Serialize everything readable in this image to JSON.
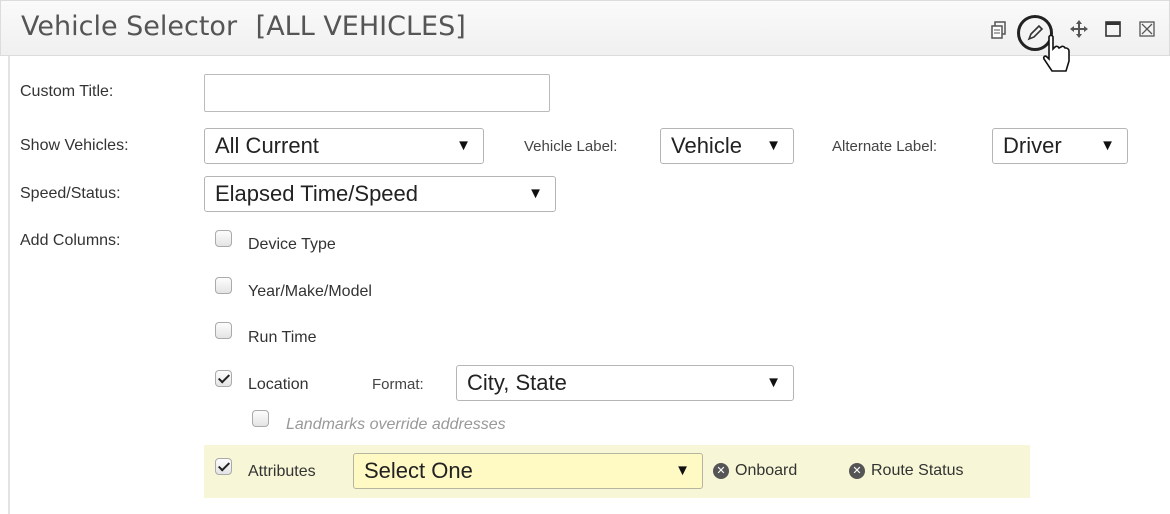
{
  "header": {
    "title": "Vehicle Selector",
    "title_tag": "[ALL VEHICLES]",
    "icons": [
      "copy-icon",
      "edit-icon",
      "move-icon",
      "maximize-icon",
      "close-icon"
    ]
  },
  "form": {
    "custom_title": {
      "label": "Custom Title:",
      "value": ""
    },
    "show_vehicles": {
      "label": "Show Vehicles:",
      "value": "All Current"
    },
    "vehicle_label": {
      "label": "Vehicle Label:",
      "value": "Vehicle"
    },
    "alternate_label": {
      "label": "Alternate Label:",
      "value": "Driver"
    },
    "speed_status": {
      "label": "Speed/Status:",
      "value": "Elapsed Time/Speed"
    },
    "add_columns": {
      "label": "Add Columns:",
      "device_type": {
        "label": "Device Type",
        "checked": false
      },
      "year_make_model": {
        "label": "Year/Make/Model",
        "checked": false
      },
      "run_time": {
        "label": "Run Time",
        "checked": false
      },
      "location": {
        "label": "Location",
        "checked": true,
        "format_label": "Format:",
        "format_value": "City, State"
      },
      "landmarks": {
        "label": "Landmarks override addresses",
        "checked": false
      },
      "attributes": {
        "label": "Attributes",
        "checked": true,
        "select_value": "Select One",
        "tags": [
          "Onboard",
          "Route Status"
        ]
      }
    }
  },
  "colors": {
    "attributes_highlight": "#f7f7d7",
    "select_highlight": "#fff9c4"
  }
}
